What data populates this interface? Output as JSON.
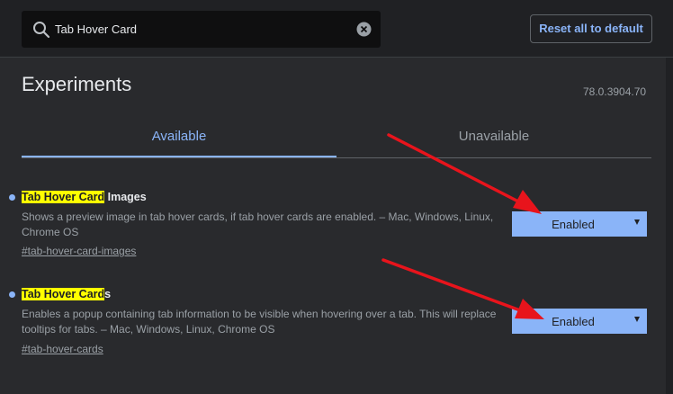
{
  "search": {
    "value": "Tab Hover Card",
    "search_icon": "search-icon",
    "clear_icon": "clear-icon"
  },
  "header": {
    "reset_label": "Reset all to default"
  },
  "page": {
    "title": "Experiments",
    "version": "78.0.3904.70"
  },
  "tabs": [
    {
      "label": "Available",
      "selected": true
    },
    {
      "label": "Unavailable",
      "selected": false
    }
  ],
  "experiments": [
    {
      "title_highlight": "Tab Hover Card",
      "title_rest": " Images",
      "description": "Shows a preview image in tab hover cards, if tab hover cards are enabled. – Mac, Windows, Linux, Chrome OS",
      "link": "#tab-hover-card-images",
      "selected_value": "Enabled"
    },
    {
      "title_highlight": "Tab Hover Card",
      "title_rest": "s",
      "description": "Enables a popup containing tab information to be visible when hovering over a tab. This will replace tooltips for tabs. – Mac, Windows, Linux, Chrome OS",
      "link": "#tab-hover-cards",
      "selected_value": "Enabled"
    }
  ],
  "colors": {
    "background": "#202124",
    "panel": "#292a2d",
    "accent": "#8ab4f8",
    "highlight": "#ffff00",
    "annotation_arrow": "#e8141c"
  }
}
